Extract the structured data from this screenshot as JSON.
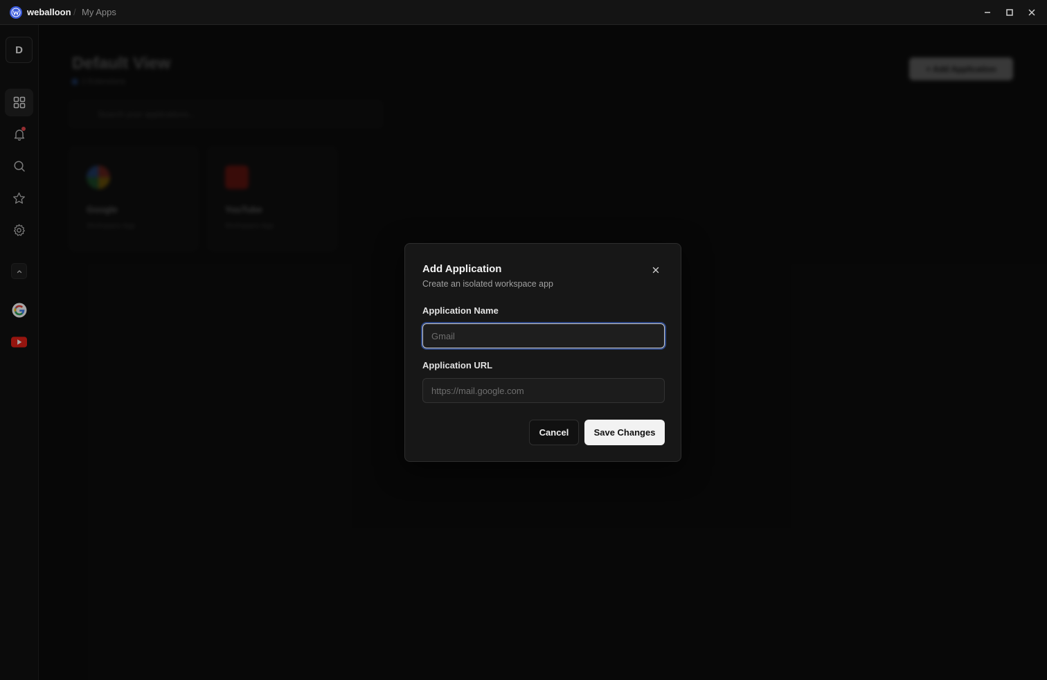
{
  "titlebar": {
    "brand": "weballoon",
    "separator": "/",
    "breadcrumb": "My Apps"
  },
  "sidebar": {
    "avatar_letter": "D",
    "items": [
      {
        "icon": "grid-icon",
        "active": true
      },
      {
        "icon": "bell-icon",
        "has_notification": true
      },
      {
        "icon": "search-icon"
      },
      {
        "icon": "star-icon"
      },
      {
        "icon": "gear-icon"
      }
    ],
    "apps": [
      {
        "icon": "google-icon"
      },
      {
        "icon": "youtube-icon"
      }
    ]
  },
  "background": {
    "title": "Default View",
    "subtitle": "2 Extensions",
    "add_button": "+ Add Application",
    "search_placeholder": "Search your applications...",
    "cards": [
      {
        "name": "Google",
        "desc": "Workspace App"
      },
      {
        "name": "YouTube",
        "desc": "Workspace App"
      }
    ]
  },
  "modal": {
    "title": "Add Application",
    "description": "Create an isolated workspace app",
    "name_label": "Application Name",
    "name_placeholder": "Gmail",
    "name_value": "",
    "url_label": "Application URL",
    "url_placeholder": "https://mail.google.com",
    "url_value": "",
    "cancel_label": "Cancel",
    "save_label": "Save Changes"
  },
  "colors": {
    "background": "#0c0c0c",
    "accent": "#3b5bdb",
    "focus_ring": "#2f4a8a",
    "notification": "#e5484d",
    "youtube": "#e62117"
  }
}
